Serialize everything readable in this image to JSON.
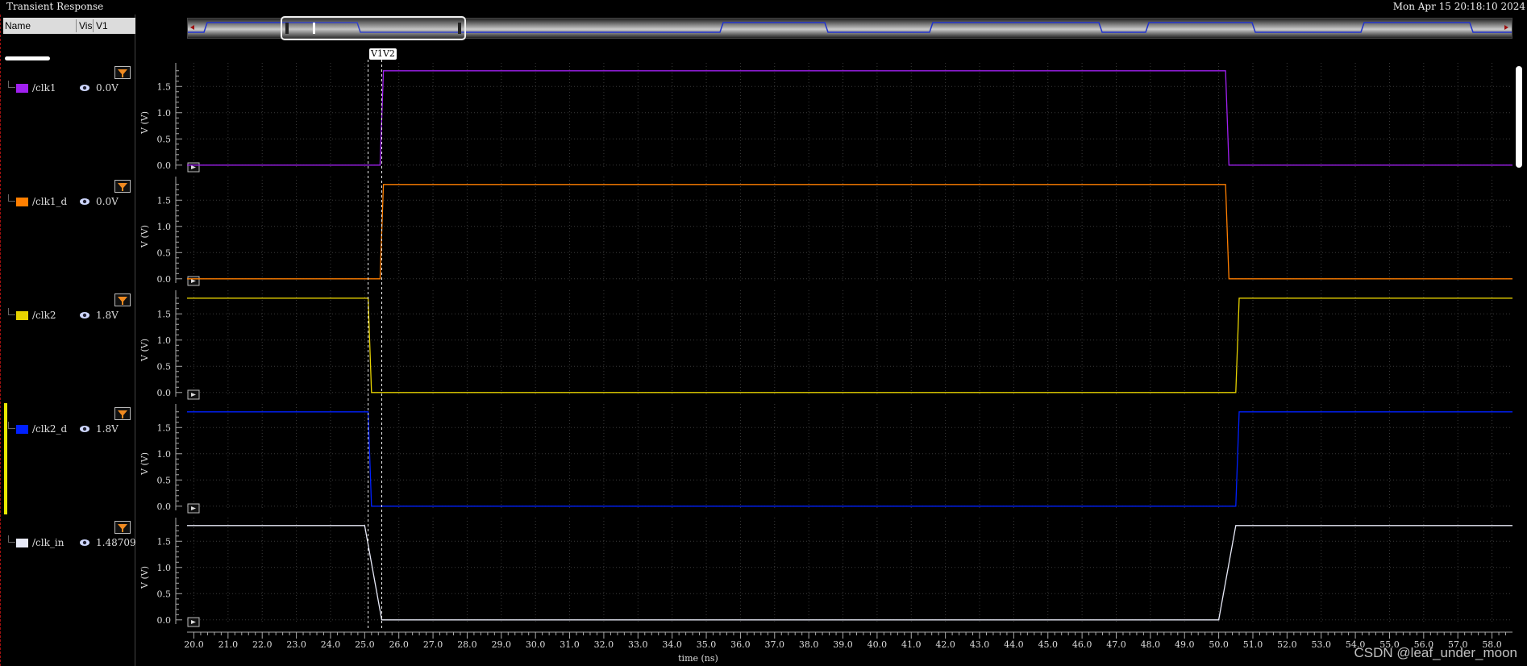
{
  "window": {
    "title": "Transient Response",
    "timestamp": "Mon Apr 15 20:18:10 2024"
  },
  "panel": {
    "columns": [
      "Name",
      "Vis",
      "V1"
    ]
  },
  "cursors": {
    "label": "V1V2",
    "v1_time": 25.1,
    "v2_time": 25.5
  },
  "colors": {
    "clk1": "#a020f0",
    "clk1_d": "#ff7f00",
    "clk2": "#e6d200",
    "clk2_d": "#0020ff",
    "clk_in": "#e8eaf8"
  },
  "signals": [
    {
      "name": "/clk1",
      "value": "0.0V",
      "color": "#a020f0",
      "swatch": "#a020f0"
    },
    {
      "name": "/clk1_d",
      "value": "0.0V",
      "color": "#ff7f00",
      "swatch": "#ff7f00"
    },
    {
      "name": "/clk2",
      "value": "1.8V",
      "color": "#e6d200",
      "swatch": "#e6d200"
    },
    {
      "name": "/clk2_d",
      "value": "1.8V",
      "color": "#0020ff",
      "swatch": "#0020ff"
    },
    {
      "name": "/clk_in",
      "value": "1.48709",
      "color": "#e8eaf8",
      "swatch": "#e8eaf8"
    }
  ],
  "chart_data": {
    "type": "line",
    "xlabel": "time (ns)",
    "ylabel": "V (V)",
    "xlim": [
      19.8,
      58.6
    ],
    "ylim": [
      -0.08,
      1.95
    ],
    "x_ticks": [
      "20.0",
      "21.0",
      "22.0",
      "23.0",
      "24.0",
      "25.0",
      "26.0",
      "27.0",
      "28.0",
      "29.0",
      "30.0",
      "31.0",
      "32.0",
      "33.0",
      "34.0",
      "35.0",
      "36.0",
      "37.0",
      "38.0",
      "39.0",
      "40.0",
      "41.0",
      "42.0",
      "43.0",
      "44.0",
      "45.0",
      "46.0",
      "47.0",
      "48.0",
      "49.0",
      "50.0",
      "51.0",
      "52.0",
      "53.0",
      "54.0",
      "55.0",
      "56.0",
      "57.0",
      "58.0"
    ],
    "y_ticks": [
      "0.0",
      "0.5",
      "1.0",
      "1.5"
    ],
    "grid": true,
    "series": [
      {
        "name": "/clk1",
        "x": [
          19.8,
          25.45,
          25.55,
          50.2,
          50.3,
          58.6
        ],
        "y": [
          0.0,
          0.0,
          1.8,
          1.8,
          0.0,
          0.0
        ]
      },
      {
        "name": "/clk1_d",
        "x": [
          19.8,
          25.45,
          25.55,
          50.2,
          50.3,
          58.6
        ],
        "y": [
          0.0,
          0.0,
          1.8,
          1.8,
          0.0,
          0.0
        ]
      },
      {
        "name": "/clk2",
        "x": [
          19.8,
          25.1,
          25.2,
          50.5,
          50.6,
          58.6
        ],
        "y": [
          1.8,
          1.8,
          0.0,
          0.0,
          1.8,
          1.8
        ]
      },
      {
        "name": "/clk2_d",
        "x": [
          19.8,
          25.1,
          25.2,
          50.5,
          50.6,
          58.6
        ],
        "y": [
          1.8,
          1.8,
          0.0,
          0.0,
          1.8,
          1.8
        ]
      },
      {
        "name": "/clk_in",
        "x": [
          19.8,
          25.0,
          25.5,
          50.0,
          50.5,
          58.6
        ],
        "y": [
          1.8,
          1.8,
          0.0,
          0.0,
          1.8,
          1.8
        ]
      }
    ]
  },
  "watermark": "CSDN @leaf_under_moon"
}
